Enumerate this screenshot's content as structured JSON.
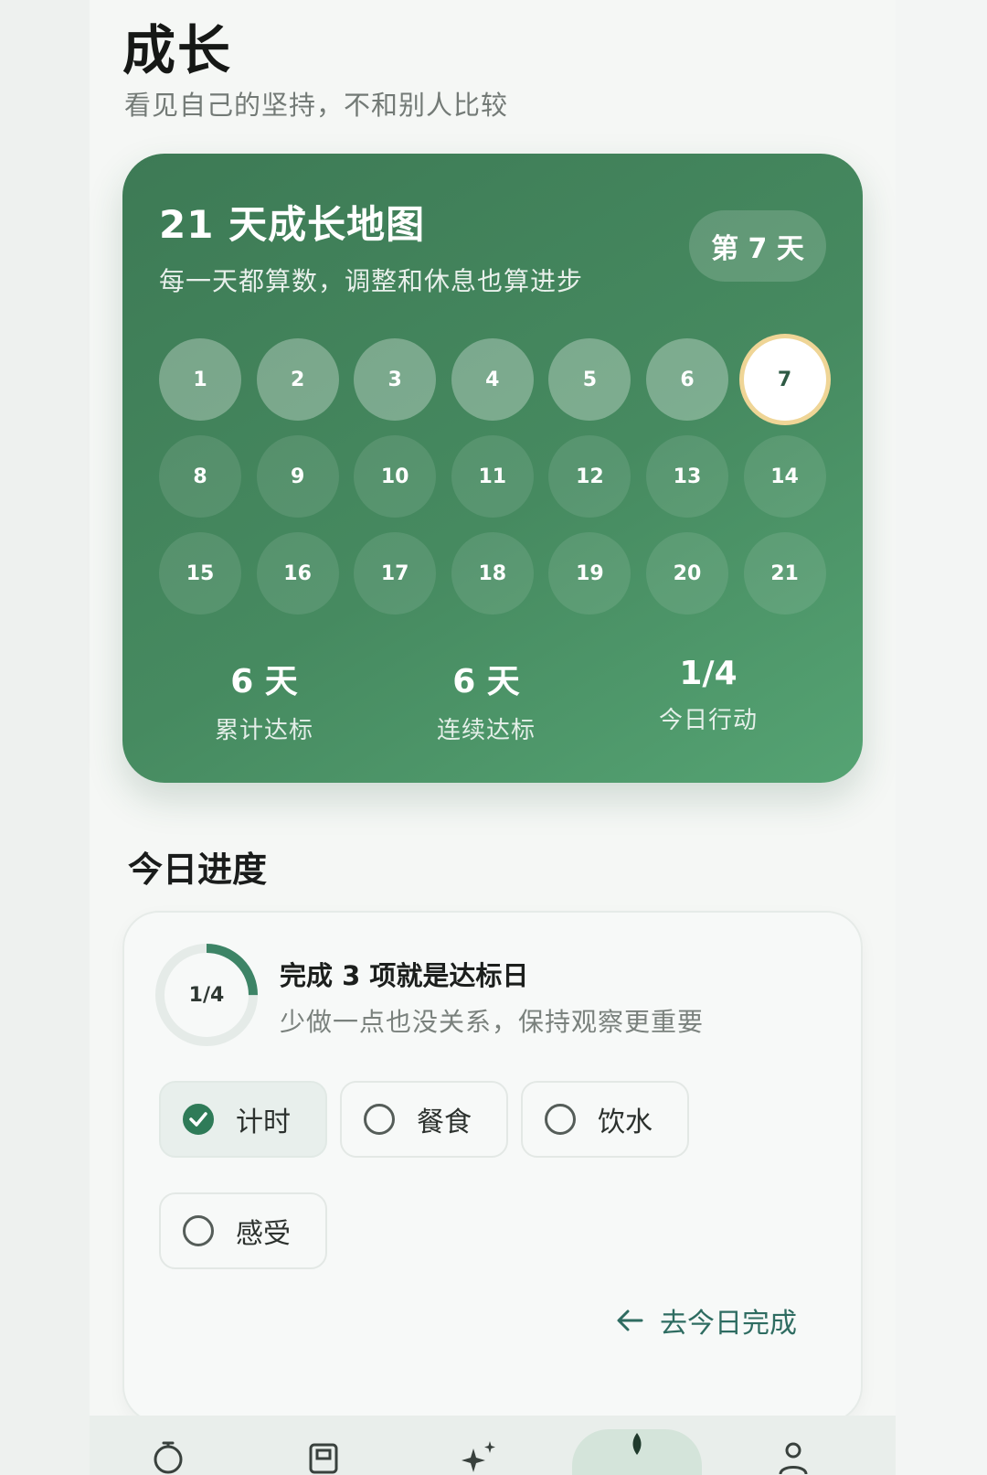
{
  "header": {
    "title": "成长",
    "subtitle": "看见自己的坚持，不和别人比较"
  },
  "growth_map": {
    "title": "21 天成长地图",
    "subtitle": "每一天都算数，调整和休息也算进步",
    "current_day_label": "第 7 天",
    "days": [
      "1",
      "2",
      "3",
      "4",
      "5",
      "6",
      "7",
      "8",
      "9",
      "10",
      "11",
      "12",
      "13",
      "14",
      "15",
      "16",
      "17",
      "18",
      "19",
      "20",
      "21"
    ],
    "completed_days": 6,
    "current_day": 7,
    "stats": [
      {
        "value": "6 天",
        "label": "累计达标"
      },
      {
        "value": "6 天",
        "label": "连续达标"
      },
      {
        "value": "1/4",
        "label": "今日行动"
      }
    ]
  },
  "today": {
    "section_title": "今日进度",
    "ring_label": "1/4",
    "progress_fraction": 0.25,
    "goal_title": "完成 3 项就是达标日",
    "goal_desc": "少做一点也没关系，保持观察更重要",
    "items": [
      {
        "label": "计时",
        "checked": true
      },
      {
        "label": "餐食",
        "checked": false
      },
      {
        "label": "饮水",
        "checked": false
      },
      {
        "label": "感受",
        "checked": false
      }
    ],
    "go_link": "去今日完成"
  },
  "nav": {
    "icons": [
      "timer-icon",
      "journal-icon",
      "sparkle-icon",
      "sprout-icon",
      "profile-icon"
    ],
    "active_index": 3
  },
  "colors": {
    "accent": "#2f7b58",
    "card_gradient_start": "#3d7a55",
    "card_gradient_end": "#55a373",
    "current_day_ring": "#efd596"
  }
}
